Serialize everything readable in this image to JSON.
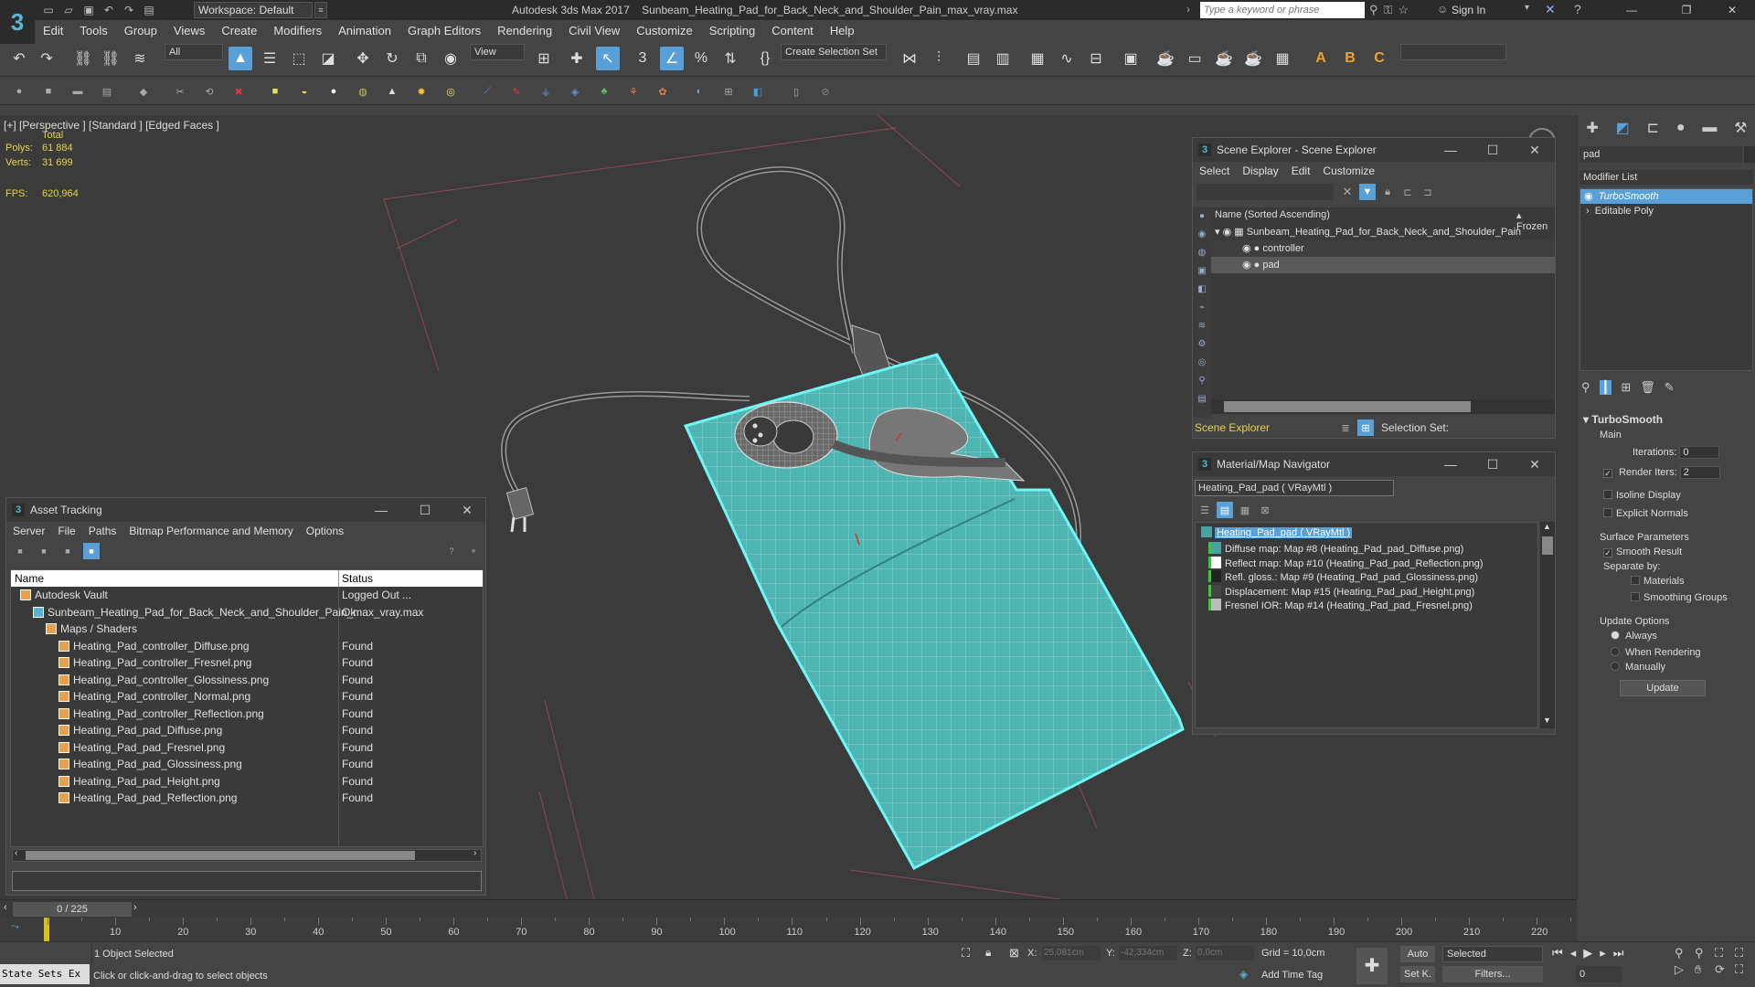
{
  "window": {
    "logo": "3",
    "workspace": "Workspace: Default",
    "app_title": "Autodesk 3ds Max 2017",
    "file_title": "Sunbeam_Heating_Pad_for_Back_Neck_and_Shoulder_Pain_max_vray.max",
    "search_placeholder": "Type a keyword or phrase",
    "sign_in": "Sign In"
  },
  "menu": [
    "Edit",
    "Tools",
    "Group",
    "Views",
    "Create",
    "Modifiers",
    "Animation",
    "Graph Editors",
    "Rendering",
    "Civil View",
    "Customize",
    "Scripting",
    "Content",
    "Help"
  ],
  "toolbar": {
    "filter_all": "All",
    "ref_coord": "View",
    "selection_set": "Create Selection Set"
  },
  "viewport": {
    "label": "[+] [Perspective ] [Standard ] [Edged Faces ]",
    "total_label": "Total",
    "polys_label": "Polys:",
    "polys_value": "61 884",
    "verts_label": "Verts:",
    "verts_value": "31 699",
    "fps_label": "FPS:",
    "fps_value": "620,964"
  },
  "asset_tracking": {
    "title": "Asset Tracking",
    "menu": [
      "Server",
      "File",
      "Paths",
      "Bitmap Performance and Memory",
      "Options"
    ],
    "col_name": "Name",
    "col_status": "Status",
    "rows": [
      {
        "name": "Autodesk Vault",
        "status": "Logged Out ...",
        "indent": 0
      },
      {
        "name": "Sunbeam_Heating_Pad_for_Back_Neck_and_Shoulder_Pain_max_vray.max",
        "status": "Ok",
        "indent": 1
      },
      {
        "name": "Maps / Shaders",
        "status": "",
        "indent": 2
      },
      {
        "name": "Heating_Pad_controller_Diffuse.png",
        "status": "Found",
        "indent": 3
      },
      {
        "name": "Heating_Pad_controller_Fresnel.png",
        "status": "Found",
        "indent": 3
      },
      {
        "name": "Heating_Pad_controller_Glossiness.png",
        "status": "Found",
        "indent": 3
      },
      {
        "name": "Heating_Pad_controller_Normal.png",
        "status": "Found",
        "indent": 3
      },
      {
        "name": "Heating_Pad_controller_Reflection.png",
        "status": "Found",
        "indent": 3
      },
      {
        "name": "Heating_Pad_pad_Diffuse.png",
        "status": "Found",
        "indent": 3
      },
      {
        "name": "Heating_Pad_pad_Fresnel.png",
        "status": "Found",
        "indent": 3
      },
      {
        "name": "Heating_Pad_pad_Glossiness.png",
        "status": "Found",
        "indent": 3
      },
      {
        "name": "Heating_Pad_pad_Height.png",
        "status": "Found",
        "indent": 3
      },
      {
        "name": "Heating_Pad_pad_Reflection.png",
        "status": "Found",
        "indent": 3
      }
    ]
  },
  "scene_explorer": {
    "title": "Scene Explorer - Scene Explorer",
    "menu": [
      "Select",
      "Display",
      "Edit",
      "Customize"
    ],
    "col_name": "Name (Sorted Ascending)",
    "col_frozen": "▴ Frozen",
    "root": "Sunbeam_Heating_Pad_for_Back_Neck_and_Shoulder_Pain",
    "children": [
      "controller",
      "pad"
    ],
    "footer_label": "Scene Explorer",
    "selection_set": "Selection Set:"
  },
  "material_nav": {
    "title": "Material/Map Navigator",
    "current": "Heating_Pad_pad  ( VRayMtl )",
    "root": "Heating_Pad_pad  ( VRayMtl )",
    "maps": [
      {
        "label": "Diffuse map: Map #8 (Heating_Pad_pad_Diffuse.png)",
        "swatch": "#4aa3a0"
      },
      {
        "label": "Reflect map: Map #10 (Heating_Pad_pad_Reflection.png)",
        "swatch": "#ffffff"
      },
      {
        "label": "Refl. gloss.: Map #9 (Heating_Pad_pad_Glossiness.png)",
        "swatch": "#222222"
      },
      {
        "label": "Displacement: Map #15 (Heating_Pad_pad_Height.png)",
        "swatch": "#444444"
      },
      {
        "label": "Fresnel IOR: Map #14 (Heating_Pad_pad_Fresnel.png)",
        "swatch": "#bbbbbb"
      }
    ]
  },
  "command_panel": {
    "object_name": "pad",
    "modifier_list": "Modifier List",
    "stack": [
      "TurboSmooth",
      "Editable Poly"
    ],
    "rollout_title": "TurboSmooth",
    "main": "Main",
    "iterations_label": "Iterations:",
    "iterations_value": "0",
    "render_iters_label": "Render Iters:",
    "render_iters_value": "2",
    "isoline": "Isoline Display",
    "explicit_normals": "Explicit Normals",
    "surface_params": "Surface Parameters",
    "smooth_result": "Smooth Result",
    "separate_by": "Separate by:",
    "materials": "Materials",
    "smoothing_groups": "Smoothing Groups",
    "update_options": "Update Options",
    "always": "Always",
    "when_rendering": "When Rendering",
    "manually": "Manually",
    "update_btn": "Update"
  },
  "timeline": {
    "frame_counter": "0 / 225",
    "ticks": [
      "10",
      "20",
      "30",
      "40",
      "50",
      "60",
      "70",
      "80",
      "90",
      "100",
      "110",
      "120",
      "130",
      "140",
      "150",
      "160",
      "170",
      "180",
      "190",
      "200",
      "210",
      "220"
    ]
  },
  "status": {
    "state_sets": "State Sets Ex",
    "selected": "1 Object Selected",
    "prompt": "Click or click-and-drag to select objects",
    "x_label": "X:",
    "x_value": "25,081cm",
    "y_label": "Y:",
    "y_value": "-42,334cm",
    "z_label": "Z:",
    "z_value": "0,0cm",
    "grid": "Grid = 10,0cm",
    "add_time_tag": "Add Time Tag",
    "auto": "Auto",
    "set_k": "Set K.",
    "selected_dd": "Selected",
    "filters": "Filters...",
    "frame": "0"
  },
  "colors": {
    "accent": "#5aa0d8",
    "pad": "#4fb5b3",
    "pad_select": "#6ff5f5",
    "stats": "#e7d34a"
  }
}
